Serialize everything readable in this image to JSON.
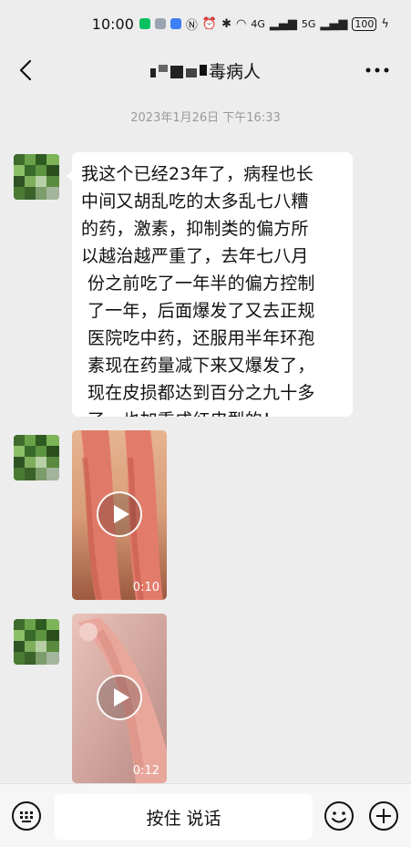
{
  "status_bar": {
    "time": "10:00",
    "network_4g": "4G",
    "network_5g": "5G",
    "battery": "100"
  },
  "header": {
    "title": "毒病人",
    "back_icon": "chevron-left-icon",
    "more_icon": "ellipsis-icon"
  },
  "chat": {
    "timestamp": "2023年1月26日 下午16:33",
    "text_message": {
      "lines": [
        "我这个已经23年了，病程也长",
        "中间又胡乱吃的太多乱七八糟",
        "的药，激素，抑制类的偏方所",
        "以越治越严重了，去年七八月",
        "份之前吃了一年半的偏方控制",
        "了一年，后面爆发了又去正规",
        "医院吃中药，还服用半年环孢",
        "素现在药量减下来又爆发了，",
        "现在皮损都达到百分之九十多",
        "了，也加重成红皮型的！"
      ]
    },
    "videos": [
      {
        "duration": "0:10"
      },
      {
        "duration": "0:12"
      }
    ]
  },
  "input_bar": {
    "hold_to_talk_label": "按住 说话",
    "keyboard_icon": "keyboard-icon",
    "emoji_icon": "smiley-icon",
    "plus_icon": "plus-icon"
  },
  "colors": {
    "background": "#ededed",
    "bubble": "#ffffff",
    "timestamp_text": "#9a9a9a",
    "wechat_green": "#07c160"
  }
}
